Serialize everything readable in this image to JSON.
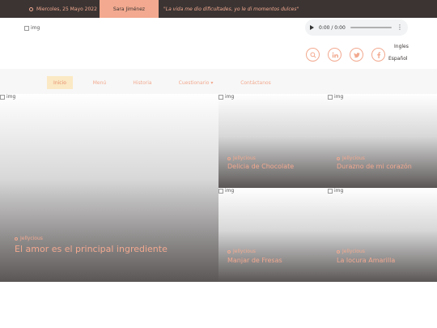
{
  "topbar": {
    "date": "Miercoles, 25 Mayo 2022",
    "author": "Sara Jiménez",
    "quote": "\"La vida me dio dificultades, yo le di momentos dulces\""
  },
  "header": {
    "logo_alt": "img",
    "audio": {
      "time": "0:00 / 0:00"
    },
    "social": [
      "search-icon",
      "linkedin-icon",
      "twitter-icon",
      "facebook-icon"
    ],
    "languages": [
      "Ingles",
      "Español"
    ]
  },
  "nav": {
    "items": [
      {
        "label": "Inicio"
      },
      {
        "label": "Menú"
      },
      {
        "label": "Historia"
      },
      {
        "label": "Cuestionario ▾"
      },
      {
        "label": "Contáctanos"
      }
    ]
  },
  "posts": {
    "featured": {
      "img_alt": "img",
      "category": "Jellycious",
      "title": "El amor es el principal ingrediente"
    },
    "items": [
      {
        "img_alt": "img",
        "category": "Jellycious",
        "title": "Delicia de Chocolate"
      },
      {
        "img_alt": "img",
        "category": "Jellycious",
        "title": "Durazno de mi corazón"
      },
      {
        "img_alt": "img",
        "category": "Jellycious",
        "title": "Manjar de Fresas"
      },
      {
        "img_alt": "img",
        "category": "Jellycious",
        "title": "La locura Amarilla"
      }
    ]
  },
  "colors": {
    "accent": "#f2a98f",
    "dark": "#3b3433",
    "nav_active_bg": "#fae9c4"
  }
}
